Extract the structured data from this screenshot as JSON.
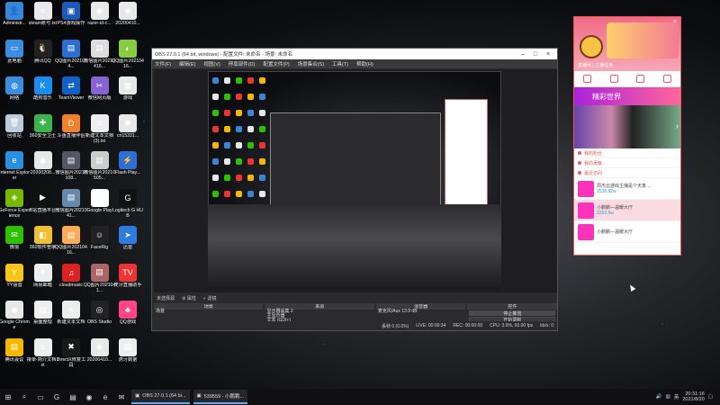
{
  "desktop_icons": [
    {
      "label": "Administr...",
      "color": "#3a86d6",
      "glyph": "👤",
      "icon": "user-folder-icon"
    },
    {
      "label": "steam账号.txt",
      "color": "#e9e9e9",
      "glyph": "≡",
      "icon": "text-file-icon"
    },
    {
      "label": "PS4游戏操作",
      "color": "#1c5ab8",
      "glyph": "▣",
      "icon": "ps4-icon"
    },
    {
      "label": "razer-id-c...",
      "color": "#e8e8e8",
      "glyph": "◉",
      "icon": "chrome-icon"
    },
    {
      "label": "20200410...",
      "color": "#e8e8e8",
      "glyph": "◉",
      "icon": "chrome-icon"
    },
    {
      "label": "此电脑",
      "color": "#3b8de0",
      "glyph": "▭",
      "icon": "computer-icon"
    },
    {
      "label": "腾讯QQ",
      "color": "#222",
      "glyph": "🐧",
      "icon": "qq-icon"
    },
    {
      "label": "QQ图片2021014...",
      "color": "#2a6ed1",
      "glyph": "▤",
      "icon": "image-file-icon"
    },
    {
      "label": "微信图片20210416...",
      "color": "#ddd",
      "glyph": "▤",
      "icon": "image-file-icon"
    },
    {
      "label": "QQ图片20210416...",
      "color": "#8c4",
      "glyph": "◐",
      "icon": "image-file-icon"
    },
    {
      "label": "网络",
      "color": "#3b8de0",
      "glyph": "◍",
      "icon": "network-icon"
    },
    {
      "label": "酷狗音乐",
      "color": "#1a8cf0",
      "glyph": "K",
      "icon": "kugou-icon"
    },
    {
      "label": "TeamViewer",
      "color": "#0e62c8",
      "glyph": "⇄",
      "icon": "teamviewer-icon"
    },
    {
      "label": "微信网页版",
      "color": "#8a63d2",
      "glyph": "✂",
      "icon": "scissors-icon"
    },
    {
      "label": "游戏",
      "color": "#e8e8e8",
      "glyph": "▦",
      "icon": "game-folder-icon"
    },
    {
      "label": "回收站",
      "color": "#bcd",
      "glyph": "🗑",
      "icon": "recycle-bin-icon"
    },
    {
      "label": "360安全卫士",
      "color": "#39b54a",
      "glyph": "✚",
      "icon": "360-icon"
    },
    {
      "label": "斗鱼直播伴侣",
      "color": "#f3812a",
      "glyph": "D",
      "icon": "douyu-icon"
    },
    {
      "label": "新建文本文档 (3).txt",
      "color": "#eee",
      "glyph": "≡",
      "icon": "text-file-icon"
    },
    {
      "label": "cn15331...",
      "color": "#e8e8e8",
      "glyph": "◉",
      "icon": "chrome-icon"
    },
    {
      "label": "Internet Explorer",
      "color": "#2b8fe0",
      "glyph": "e",
      "icon": "ie-icon"
    },
    {
      "label": "20200208...",
      "color": "#e8e8e8",
      "glyph": "◉",
      "icon": "chrome-icon"
    },
    {
      "label": "微信图片20210108...",
      "color": "#556",
      "glyph": "▤",
      "icon": "image-file-icon"
    },
    {
      "label": "微信图片20210505...",
      "color": "#ccc",
      "glyph": "▤",
      "icon": "image-file-icon"
    },
    {
      "label": "Flash Play...",
      "color": "#2e6fd6",
      "glyph": "⚡",
      "icon": "flash-icon"
    },
    {
      "label": "GeForce Experience",
      "color": "#76b900",
      "glyph": "◈",
      "icon": "geforce-icon"
    },
    {
      "label": "B站直播平台",
      "color": "#111",
      "glyph": "▶",
      "icon": "bilibili-icon"
    },
    {
      "label": "微信图片2021041...",
      "color": "#68a",
      "glyph": "▤",
      "icon": "image-file-icon"
    },
    {
      "label": "Google Play",
      "color": "#fff",
      "glyph": "▶",
      "icon": "play-icon"
    },
    {
      "label": "Logitech G HUB",
      "color": "#111",
      "glyph": "G",
      "icon": "logitech-icon"
    },
    {
      "label": "微信",
      "color": "#2dc100",
      "glyph": "✉",
      "icon": "wechat-icon"
    },
    {
      "label": "360软件管家",
      "color": "#f0c030",
      "glyph": "◧",
      "icon": "software-manager-icon"
    },
    {
      "label": "QQ图片20210416...",
      "color": "#fa5",
      "glyph": "▤",
      "icon": "image-file-icon"
    },
    {
      "label": "FaceRig",
      "color": "#222",
      "glyph": "☺",
      "icon": "facerig-icon"
    },
    {
      "label": "迅雷",
      "color": "#2d7bdf",
      "glyph": "➤",
      "icon": "xunlei-icon"
    },
    {
      "label": "YY语音",
      "color": "#f5c518",
      "glyph": "Y",
      "icon": "yy-icon"
    },
    {
      "label": "网易邮箱",
      "color": "#eee",
      "glyph": "✦",
      "icon": "mail-icon"
    },
    {
      "label": "cloudmusic",
      "color": "#d22",
      "glyph": "♫",
      "icon": "cloudmusic-icon"
    },
    {
      "label": "QQ图片2021041...",
      "color": "#a66",
      "glyph": "▤",
      "icon": "image-file-icon"
    },
    {
      "label": "虎牙直播助手",
      "color": "#e33",
      "glyph": "TV",
      "icon": "huya-icon"
    },
    {
      "label": "Google Chrome",
      "color": "#e8e8e8",
      "glyph": "◉",
      "icon": "chrome-icon"
    },
    {
      "label": "桌面整理",
      "color": "#eee",
      "glyph": "▤",
      "icon": "document-icon"
    },
    {
      "label": "新建文本文档",
      "color": "#eee",
      "glyph": "≡",
      "icon": "text-file-icon"
    },
    {
      "label": "OBS Studio",
      "color": "#222",
      "glyph": "◎",
      "icon": "obs-icon"
    },
    {
      "label": "QQ游戏",
      "color": "#f48",
      "glyph": "♣",
      "icon": "qq-game-icon"
    },
    {
      "label": "腾讯会议",
      "color": "#f5b800",
      "glyph": "▤",
      "icon": "folder-icon"
    },
    {
      "label": "接单-简介文档.txt",
      "color": "#eee",
      "glyph": "≡",
      "icon": "text-file-icon"
    },
    {
      "label": "DirectX修复工具",
      "color": "#1a1a1a",
      "glyph": "✖",
      "icon": "directx-icon"
    },
    {
      "label": "20200410...",
      "color": "#e8e8e8",
      "glyph": "◉",
      "icon": "chrome-icon"
    },
    {
      "label": "虎牙数据",
      "color": "#eee",
      "glyph": "▤",
      "icon": "document-icon"
    }
  ],
  "obs": {
    "title": "OBS 27.0.1 (64 bit, windows) - 配置文件: 未命名 - 场景: 未命名",
    "menu": [
      "文件(F)",
      "编辑(E)",
      "视图(V)",
      "停靠部件(D)",
      "配置文件(P)",
      "场景集合(S)",
      "工具(T)",
      "帮助(H)"
    ],
    "source_bar": {
      "no_source": "未选择源",
      "properties": "属性",
      "filters": "滤镜"
    },
    "docks": {
      "scenes": {
        "title": "场景",
        "items": [
          "场景"
        ]
      },
      "sources": {
        "title": "来源",
        "items": [
          "显示器采集 2",
          "主显示器",
          "文本 (GDI+)",
          "文本 (GDI+) 2",
          "图像幻灯片 3",
          "显示器采集"
        ]
      },
      "mixer": {
        "title": "混音器",
        "items": [
          {
            "name": "麦克风/Aux",
            "level": "13.9 dB"
          },
          {
            "name": "桌面音频",
            "level": "0.0 dB"
          }
        ]
      },
      "transitions": {
        "title": "转场特效",
        "items": [
          "淡入淡出",
          "时长 300 ms"
        ]
      },
      "controls": {
        "title": "控件",
        "items": [
          "停止推流",
          "开始录制",
          "启动虚拟摄像机",
          "工作室模式",
          "设置",
          "退出"
        ]
      }
    },
    "status": {
      "dropped": "丢帧 0 (0.0%)",
      "live": "LIVE: 00:00:34",
      "rec": "REC: 00:00:00",
      "cpu": "CPU: 3.9%, 60.00 fps",
      "kbps": "发送 0.00 MB",
      "rate": "kb/s: 0"
    }
  },
  "pink_panel": {
    "sub_title": "直播间 | 主播任务",
    "promo": "精彩世界",
    "menu": [
      "我的粉丝",
      "我的贡献",
      "最近访问"
    ],
    "cards": [
      {
        "title": "周杰云游戏主播是个天真 ...",
        "sub": "2538.92w"
      },
      {
        "title": "小鹏鹏—温暖大厅",
        "sub": "2253.9w"
      },
      {
        "title": "小鹏鹏—温暖大厅",
        "sub": ""
      }
    ]
  },
  "taskbar": {
    "tasks": [
      {
        "label": "OBS 27.0.1 (64 bi...",
        "icon": "obs-icon"
      },
      {
        "label": "539559 - 小鹏鹏...",
        "icon": "huya-icon"
      }
    ],
    "lang": "英",
    "time": "20:31:16",
    "date": "2021/8/20"
  }
}
